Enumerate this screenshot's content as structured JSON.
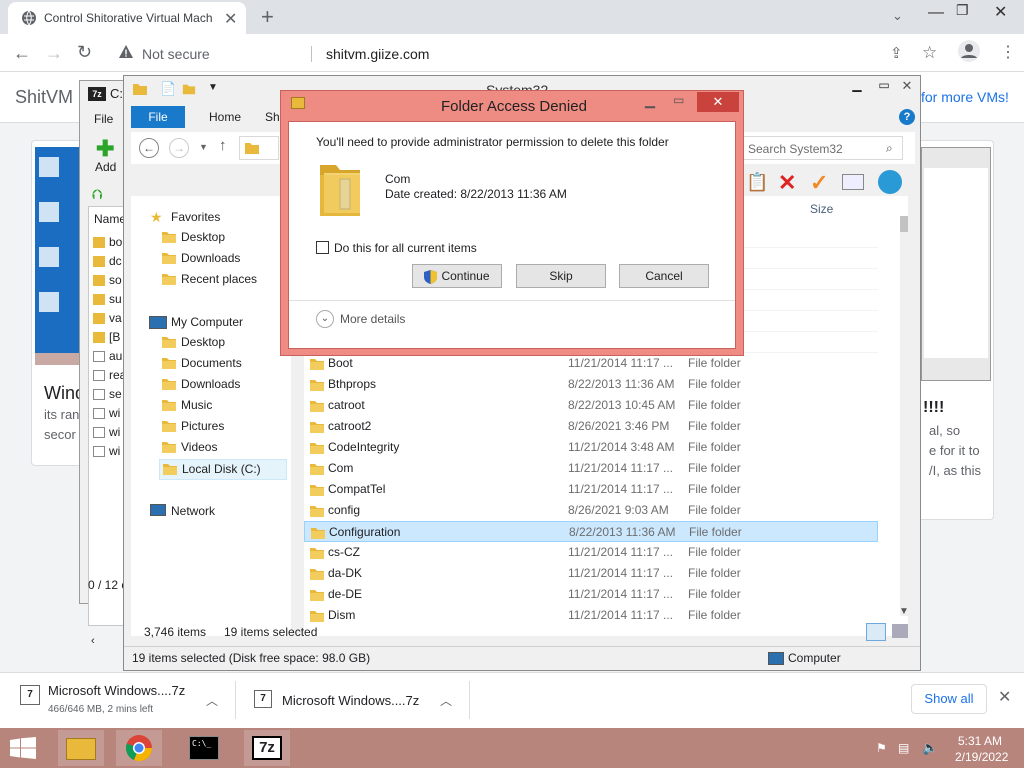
{
  "browser": {
    "tab_title": "Control Shitorative Virtual Machi",
    "not_secure": "Not secure",
    "url": "shitvm.giize.com"
  },
  "page": {
    "brand": "ShitVM",
    "more_vms": "for more VMs!",
    "left_card": {
      "heading": "Wind",
      "line1": "its ran",
      "line2": "secor"
    },
    "right_card": {
      "excl": "!!!!",
      "line1": "al, so",
      "line2": "e for it to",
      "line3": "/I, as this"
    }
  },
  "sevenzip": {
    "title": "C:",
    "menu_file": "File",
    "add_label": "Add",
    "col_name": "Name",
    "items": [
      "bo",
      "dc",
      "so",
      "su",
      "va",
      "[B",
      "au",
      "rea",
      "se",
      "wi",
      "wi",
      "wi"
    ],
    "status": "0 / 12 o"
  },
  "explorer": {
    "title": "System32",
    "tabs": [
      "File",
      "Home",
      "Shar"
    ],
    "search_placeholder": "Search System32",
    "col_size": "Size",
    "tree": {
      "favorites": "Favorites",
      "fav_items": [
        "Desktop",
        "Downloads",
        "Recent places"
      ],
      "computer": "My Computer",
      "pc_items": [
        "Desktop",
        "Documents",
        "Downloads",
        "Music",
        "Pictures",
        "Videos",
        "Local Disk (C:)"
      ],
      "network": "Network"
    },
    "rows": [
      {
        "name": "Boot",
        "date": "11/21/2014 11:17 ...",
        "type": "File folder"
      },
      {
        "name": "Bthprops",
        "date": "8/22/2013 11:36 AM",
        "type": "File folder"
      },
      {
        "name": "catroot",
        "date": "8/22/2013 10:45 AM",
        "type": "File folder"
      },
      {
        "name": "catroot2",
        "date": "8/26/2021 3:46 PM",
        "type": "File folder"
      },
      {
        "name": "CodeIntegrity",
        "date": "11/21/2014 3:48 AM",
        "type": "File folder"
      },
      {
        "name": "Com",
        "date": "11/21/2014 11:17 ...",
        "type": "File folder"
      },
      {
        "name": "CompatTel",
        "date": "11/21/2014 11:17 ...",
        "type": "File folder"
      },
      {
        "name": "config",
        "date": "8/26/2021 9:03 AM",
        "type": "File folder"
      },
      {
        "name": "Configuration",
        "date": "8/22/2013 11:36 AM",
        "type": "File folder"
      },
      {
        "name": "cs-CZ",
        "date": "11/21/2014 11:17 ...",
        "type": "File folder"
      },
      {
        "name": "da-DK",
        "date": "11/21/2014 11:17 ...",
        "type": "File folder"
      },
      {
        "name": "de-DE",
        "date": "11/21/2014 11:17 ...",
        "type": "File folder"
      },
      {
        "name": "Dism",
        "date": "11/21/2014 11:17 ...",
        "type": "File folder"
      }
    ],
    "status_items": "3,746 items",
    "status_selected": "19 items selected",
    "details_text": "19 items selected (Disk free space: 98.0 GB)",
    "details_computer": "Computer"
  },
  "dialog": {
    "title": "Folder Access Denied",
    "message": "You'll need to provide administrator permission to delete this folder",
    "folder_name": "Com",
    "date_created": "Date created: 8/22/2013 11:36 AM",
    "checkbox_label": "Do this for all current items",
    "continue": "Continue",
    "skip": "Skip",
    "cancel": "Cancel",
    "more_details": "More details"
  },
  "downloads": {
    "item1_name": "Microsoft Windows....7z",
    "item1_status": "466/646 MB, 2 mins left",
    "item2_name": "Microsoft Windows....7z",
    "show_all": "Show all"
  },
  "taskbar": {
    "time": "5:31 AM",
    "date": "2/19/2022"
  },
  "colors": {
    "dialog_frame": "#ee8b83",
    "taskbar": "#b8857d",
    "explorer_accent": "#1979ca",
    "selection": "#cce8ff"
  }
}
